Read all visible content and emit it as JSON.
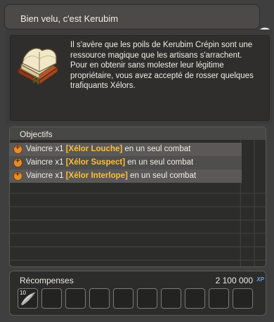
{
  "header": {
    "title": "Bien velu, c'est Kerubim"
  },
  "quest": {
    "description": "Il s'avère que les poils de Kerubim Crépin sont une ressource magique que les artisans s'arrachent. Pour en obtenir sans molester leur légitime propriétaire, vous avez accepté de rosser quelques trafiquants Xélors."
  },
  "objectives": {
    "title": "Objectifs",
    "items": [
      {
        "prefix": "Vaincre x1 ",
        "highlight": "[Xélor Louche]",
        "suffix": " en un seul combat"
      },
      {
        "prefix": "Vaincre x1 ",
        "highlight": "[Xélor Suspect]",
        "suffix": " en un seul combat"
      },
      {
        "prefix": "Vaincre x1 ",
        "highlight": "[Xélor Interlope]",
        "suffix": " en un seul combat"
      }
    ]
  },
  "rewards": {
    "title": "Récompenses",
    "xp_value": "2 100 000",
    "xp_label": "XP",
    "first_item_count": "10"
  },
  "colors": {
    "highlight": "#ffbf37",
    "bullet": "#e38d2c",
    "xp": "#5fa7e6"
  },
  "icons": [
    "chat-bubble-icon",
    "book-icon",
    "objective-bullet-icon",
    "feather-item-icon"
  ]
}
